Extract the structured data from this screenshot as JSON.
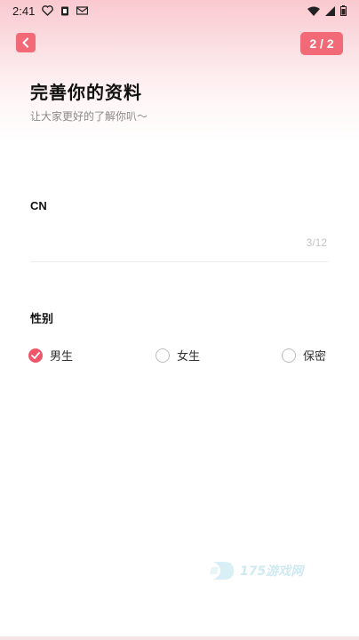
{
  "status_bar": {
    "time": "2:41",
    "icons": [
      "heart-outline-icon",
      "clipboard-icon",
      "mail-icon",
      "wifi-icon",
      "signal-icon",
      "battery-icon"
    ]
  },
  "header": {
    "back_icon": "chevron-left-icon",
    "step": "2 / 2"
  },
  "page": {
    "title": "完善你的资料",
    "subtitle": "让大家更好的了解你叭～"
  },
  "cn_field": {
    "label": "CN",
    "value": "",
    "counter": "3/12"
  },
  "gender": {
    "label": "性别",
    "options": [
      {
        "label": "男生",
        "checked": true
      },
      {
        "label": "女生",
        "checked": false
      },
      {
        "label": "保密",
        "checked": false
      }
    ]
  },
  "watermark": {
    "text": "175游戏网"
  },
  "colors": {
    "accent": "#f26a77",
    "check": "#f0566a",
    "header_gradient_top": "#f9c9cf"
  }
}
